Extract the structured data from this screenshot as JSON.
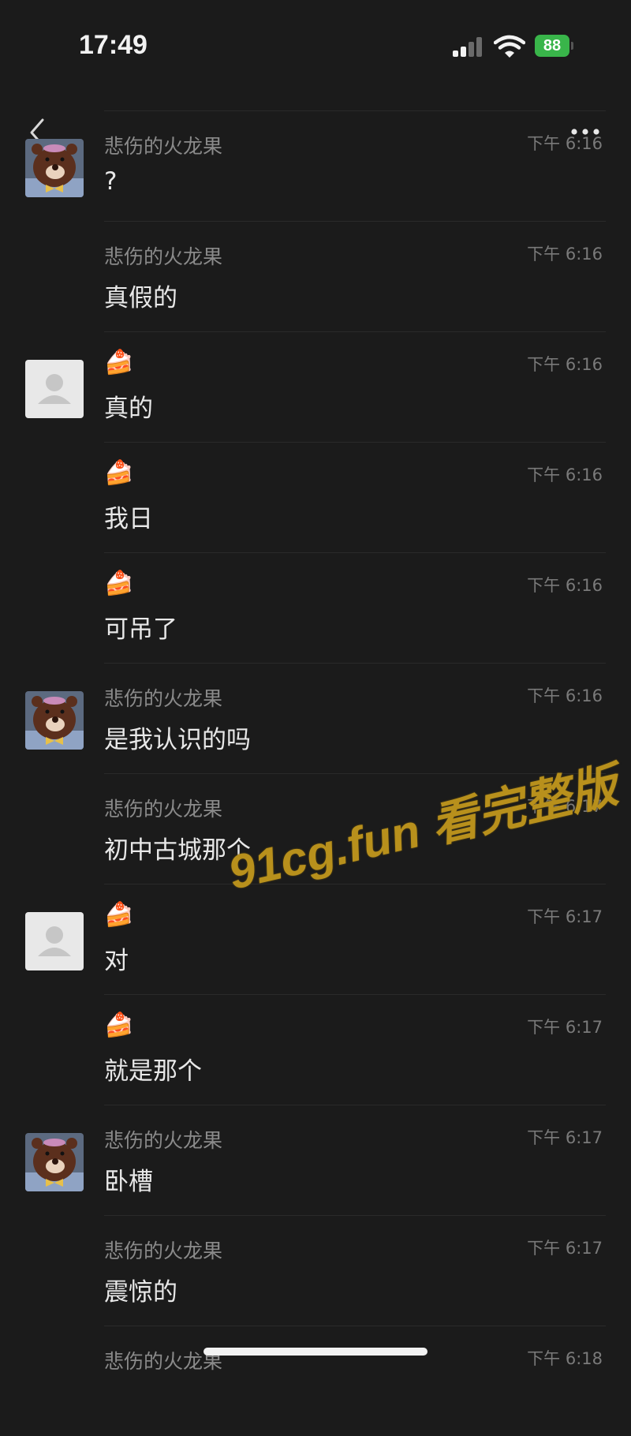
{
  "status_bar": {
    "time": "17:49",
    "battery": "88"
  },
  "messages": [
    {
      "sender": "悲伤的火龙果",
      "time": "下午 6:16",
      "text": "?",
      "avatar": "bear"
    },
    {
      "sender": "悲伤的火龙果",
      "time": "下午 6:16",
      "text": "真假的",
      "avatar": ""
    },
    {
      "sender": "🍰",
      "time": "下午 6:16",
      "text": "真的",
      "avatar": "default"
    },
    {
      "sender": "🍰",
      "time": "下午 6:16",
      "text": "我日",
      "avatar": ""
    },
    {
      "sender": "🍰",
      "time": "下午 6:16",
      "text": "可吊了",
      "avatar": ""
    },
    {
      "sender": "悲伤的火龙果",
      "time": "下午 6:16",
      "text": "是我认识的吗",
      "avatar": "bear"
    },
    {
      "sender": "悲伤的火龙果",
      "time": "下午 6:17",
      "text": "初中古城那个",
      "avatar": ""
    },
    {
      "sender": "🍰",
      "time": "下午 6:17",
      "text": "对",
      "avatar": "default"
    },
    {
      "sender": "🍰",
      "time": "下午 6:17",
      "text": "就是那个",
      "avatar": ""
    },
    {
      "sender": "悲伤的火龙果",
      "time": "下午 6:17",
      "text": "卧槽",
      "avatar": "bear"
    },
    {
      "sender": "悲伤的火龙果",
      "time": "下午 6:17",
      "text": "震惊的",
      "avatar": ""
    },
    {
      "sender": "悲伤的火龙果",
      "time": "下午 6:18",
      "text": "",
      "avatar": ""
    }
  ],
  "watermark": "91cg.fun 看完整版",
  "colors": {
    "background": "#1b1b1b",
    "watermark": "#b8901c",
    "battery": "#39b54a"
  }
}
